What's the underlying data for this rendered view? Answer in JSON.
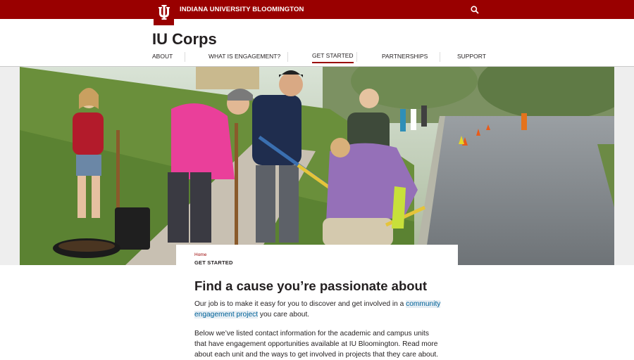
{
  "header": {
    "university_name": "INDIANA UNIVERSITY BLOOMINGTON",
    "logo_icon": "iu-trident-icon",
    "search_icon": "search-icon",
    "brand_color": "#990000"
  },
  "site": {
    "title": "IU Corps"
  },
  "nav": {
    "items": [
      {
        "label": "ABOUT",
        "active": false
      },
      {
        "label": "WHAT IS ENGAGEMENT?",
        "active": false
      },
      {
        "label": "GET STARTED",
        "active": true
      },
      {
        "label": "PARTNERSHIPS",
        "active": false
      },
      {
        "label": "SUPPORT",
        "active": false
      }
    ]
  },
  "hero": {
    "image": "photo of students volunteering, planting along a street"
  },
  "breadcrumb": {
    "home": "Home",
    "current": "GET STARTED"
  },
  "main": {
    "heading": "Find a cause you’re passionate about",
    "p1_before": "Our job is to make it easy for you to discover and get involved in a ",
    "p1_link": "community engagement project",
    "p1_after": " you care about.",
    "p2": "Below we’ve listed contact information for the academic and campus units that have engagement opportunities available at IU Bloomington. Read more about each unit and the ways to get involved in projects that they care about."
  },
  "colors": {
    "link": "#006298",
    "link_highlight": "#e7eef4",
    "text": "#231f20"
  }
}
